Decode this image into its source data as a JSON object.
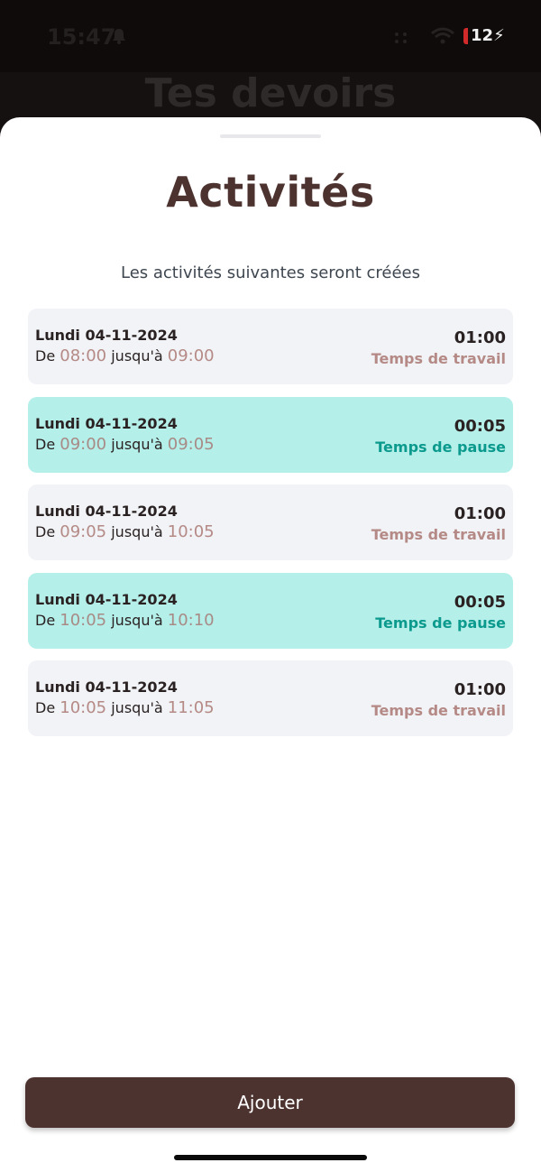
{
  "status_bar": {
    "time": "15:47",
    "battery": "12"
  },
  "background": {
    "title": "Tes devoirs"
  },
  "sheet": {
    "title": "Activités",
    "subtitle": "Les activités suivantes seront créées",
    "from_label": "De",
    "to_label": "jusqu'à",
    "activities": [
      {
        "date": "Lundi 04-11-2024",
        "start": "08:00",
        "end": "09:00",
        "duration": "01:00",
        "type": "Temps de travail",
        "kind": "work"
      },
      {
        "date": "Lundi 04-11-2024",
        "start": "09:00",
        "end": "09:05",
        "duration": "00:05",
        "type": "Temps de pause",
        "kind": "pause"
      },
      {
        "date": "Lundi 04-11-2024",
        "start": "09:05",
        "end": "10:05",
        "duration": "01:00",
        "type": "Temps de travail",
        "kind": "work"
      },
      {
        "date": "Lundi 04-11-2024",
        "start": "10:05",
        "end": "10:10",
        "duration": "00:05",
        "type": "Temps de pause",
        "kind": "pause"
      },
      {
        "date": "Lundi 04-11-2024",
        "start": "10:05",
        "end": "11:05",
        "duration": "01:00",
        "type": "Temps de travail",
        "kind": "work"
      }
    ],
    "add_button_label": "Ajouter"
  },
  "colors": {
    "brand_brown": "#4d3330",
    "pause_bg": "#b5efe9",
    "work_bg": "#f1f3f6",
    "pause_accent": "#0b9a8d",
    "time_accent": "#b58a86"
  },
  "icons": [
    "bell-icon",
    "dots-icon",
    "wifi-icon",
    "battery-icon"
  ]
}
